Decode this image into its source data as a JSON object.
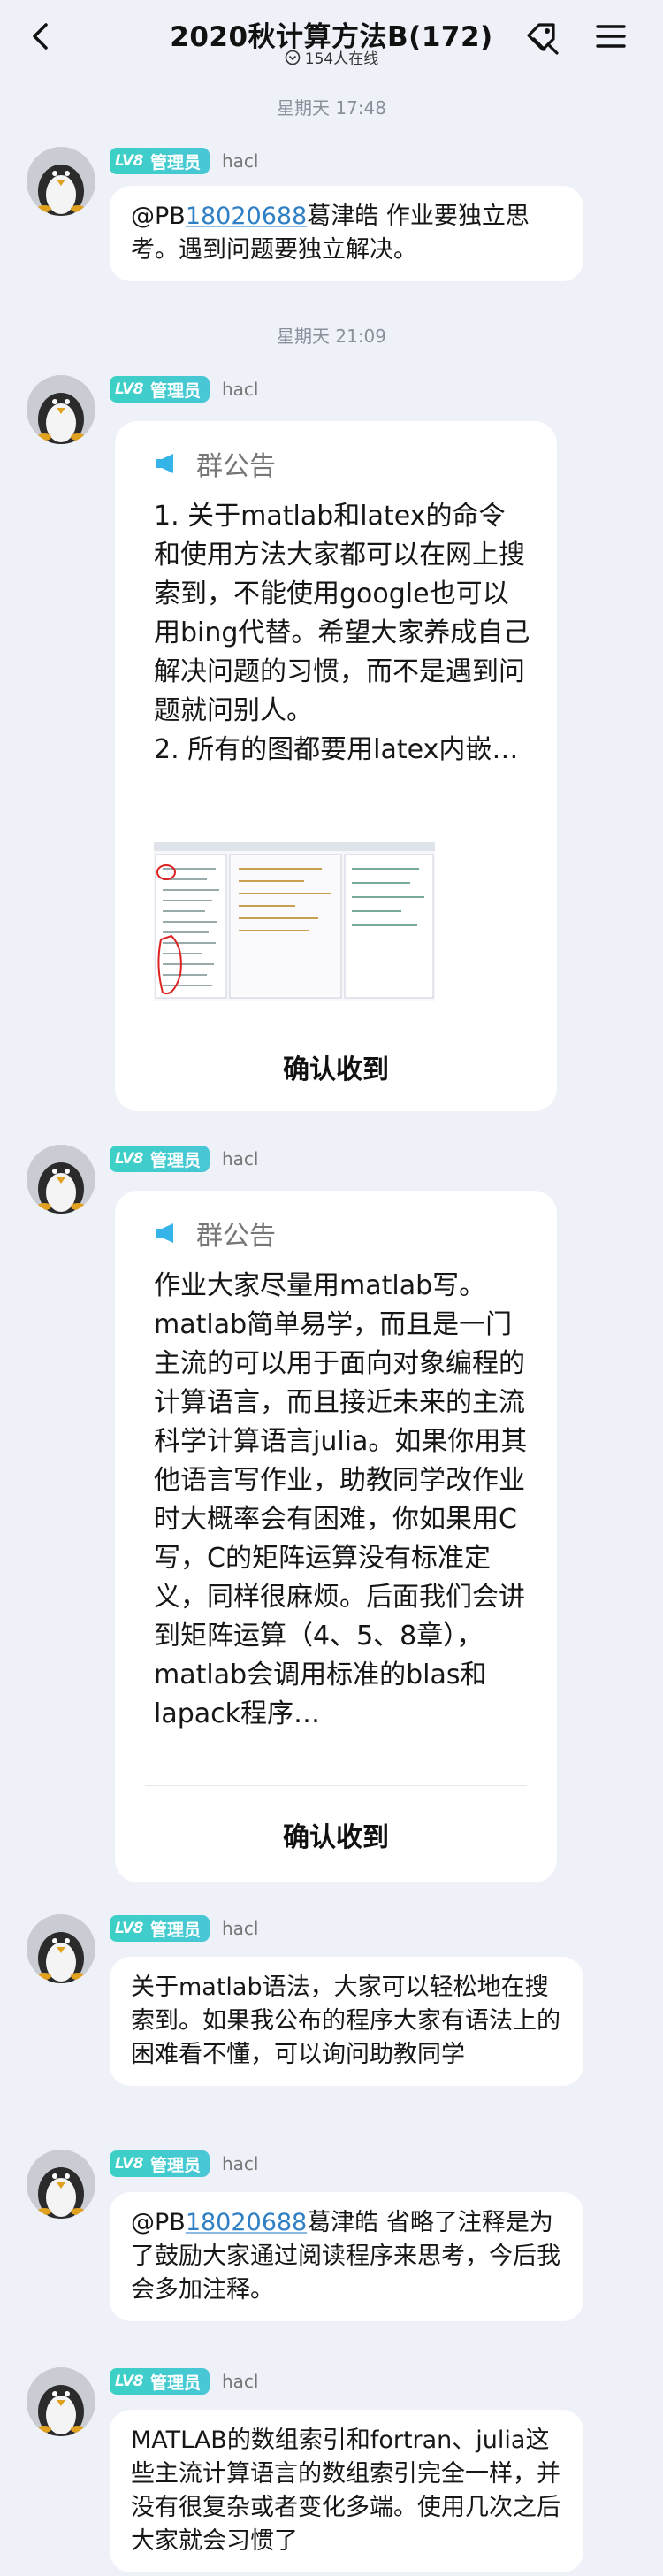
{
  "header": {
    "title": "2020秋计算方法B(172)",
    "online": "154人在线"
  },
  "timestamps": [
    "星期天 17:48",
    "星期天 21:09"
  ],
  "sender": {
    "badge_level": "LV8",
    "badge_role": "管理员",
    "nickname": "hacl"
  },
  "messages": [
    {
      "at_prefix": "@PB",
      "at_id": "18020688",
      "text": "葛津皓 作业要独立思考。遇到问题要独立解决。"
    },
    {
      "notice_label": "群公告",
      "notice_text": "1. 关于matlab和latex的命令和使用方法大家都可以在网上搜索到，不能使用google也可以用bing代替。希望大家养成自己解决问题的习惯，而不是遇到问题就问别人。\n2. 所有的图都要用latex内嵌…",
      "confirm": "确认收到"
    },
    {
      "notice_label": "群公告",
      "notice_text": "作业大家尽量用matlab写。matlab简单易学，而且是一门主流的可以用于面向对象编程的计算语言，而且接近未来的主流科学计算语言julia。如果你用其他语言写作业，助教同学改作业时大概率会有困难，你如果用C写，C的矩阵运算没有标准定义，同样很麻烦。后面我们会讲到矩阵运算（4、5、8章），matlab会调用标准的blas和lapack程序…",
      "confirm": "确认收到"
    },
    {
      "text": "关于matlab语法，大家可以轻松地在搜索到。如果我公布的程序大家有语法上的困难看不懂，可以询问助教同学"
    },
    {
      "at_prefix": "@PB",
      "at_id": "18020688",
      "text": "葛津皓 省略了注释是为了鼓励大家通过阅读程序来思考，今后我会多加注释。"
    },
    {
      "text": "MATLAB的数组索引和fortran、julia这些主流计算语言的数组索引完全一样，并没有很复杂或者变化多端。使用几次之后大家就会习惯了"
    }
  ],
  "colors": {
    "badge": "#3bd0c5",
    "mention": "#2f7fc4",
    "background": "#eef1f8",
    "speaker_icon": "#34b4e8"
  },
  "icons": [
    "back-arrow-icon",
    "group-online-icon",
    "tag-icon",
    "menu-icon",
    "megaphone-icon"
  ]
}
